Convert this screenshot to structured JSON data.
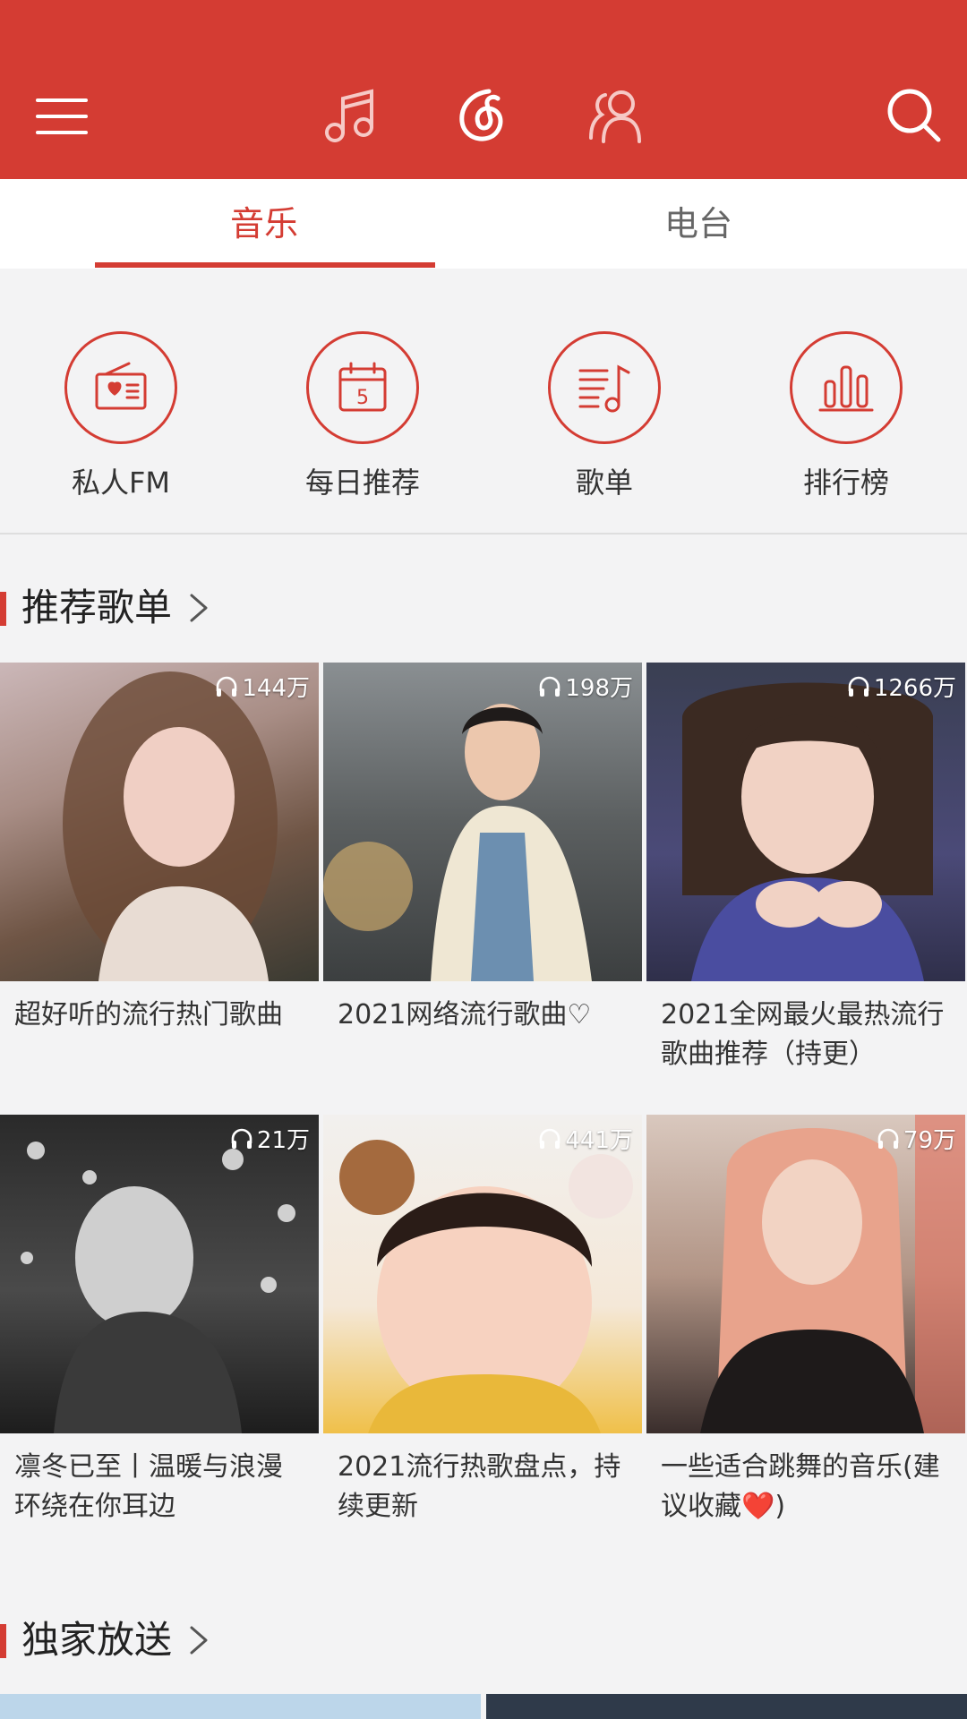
{
  "header": {
    "icons": [
      "menu-icon",
      "music-note-icon",
      "netease-logo-icon",
      "friends-icon",
      "search-icon"
    ],
    "colors": {
      "brand": "#d43c33",
      "text": "#333333",
      "muted": "#666666"
    }
  },
  "tabs": [
    {
      "label": "音乐",
      "active": true
    },
    {
      "label": "电台",
      "active": false
    }
  ],
  "entries": [
    {
      "label": "私人FM",
      "icon": "radio-icon"
    },
    {
      "label": "每日推荐",
      "icon": "calendar-icon",
      "day": "5"
    },
    {
      "label": "歌单",
      "icon": "playlist-icon"
    },
    {
      "label": "排行榜",
      "icon": "chart-icon"
    }
  ],
  "sections": {
    "recommended": "推荐歌单",
    "exclusive": "独家放送"
  },
  "playlists": [
    {
      "count": "144万",
      "title": "超好听的流行热门歌曲"
    },
    {
      "count": "198万",
      "title": "2021网络流行歌曲♡"
    },
    {
      "count": "1266万",
      "title": "2021全网最火最热流行歌曲推荐（持更）"
    },
    {
      "count": "21万",
      "title": "凛冬已至丨温暖与浪漫环绕在你耳边"
    },
    {
      "count": "441万",
      "title": "2021流行热歌盘点，持续更新"
    },
    {
      "count": "79万",
      "title": "一些适合跳舞的音乐(建议收藏❤️)"
    }
  ]
}
